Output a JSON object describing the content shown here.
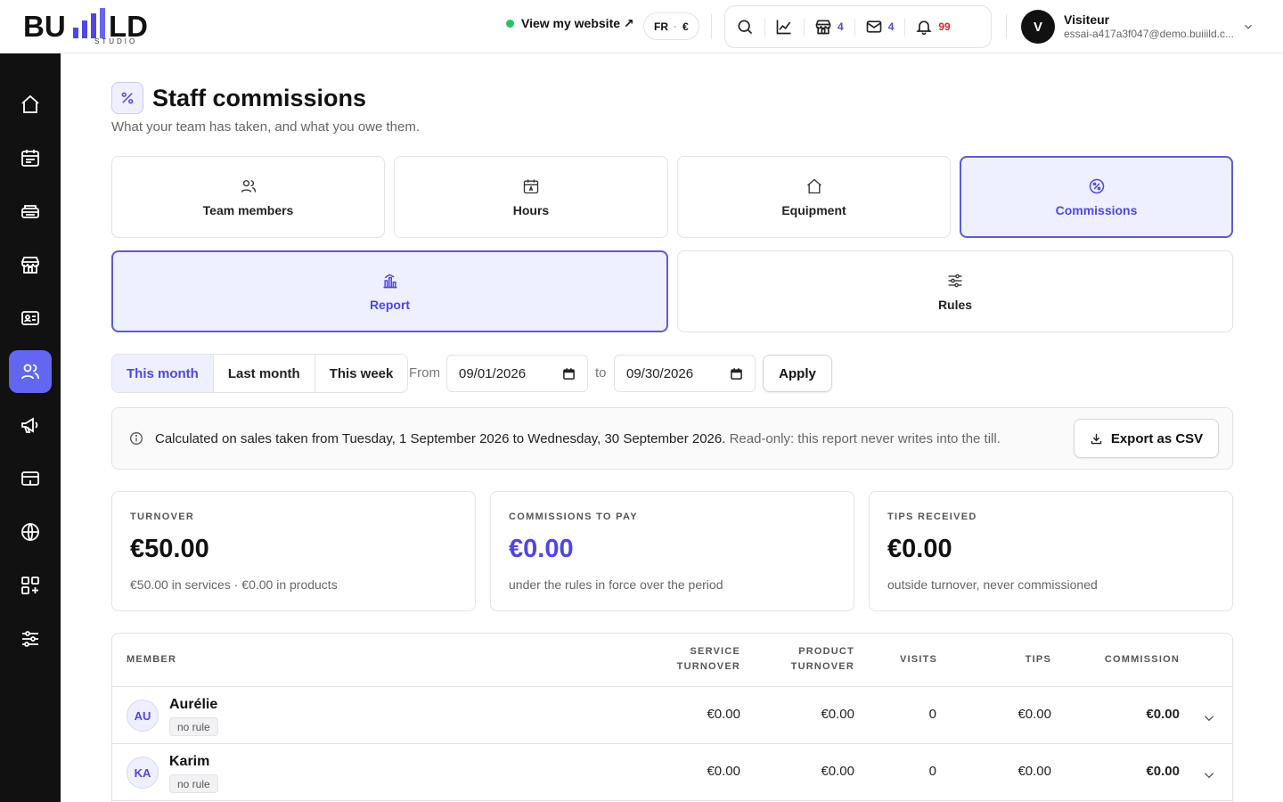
{
  "header": {
    "logo_text": "BUILD",
    "logo_sub": "STUDIO",
    "view_site": "View my website ↗",
    "lang": "FR",
    "currency": "€",
    "icons": [
      {
        "name": "search-icon",
        "count": ""
      },
      {
        "name": "chart-icon",
        "count": ""
      },
      {
        "name": "store-icon",
        "count": "4"
      },
      {
        "name": "mail-icon",
        "count": "4"
      },
      {
        "name": "bell-icon",
        "count": "99"
      }
    ],
    "user": {
      "initial": "V",
      "name": "Visiteur",
      "email": "essai-a417a3f047@demo.buiiild.c..."
    }
  },
  "sidebar": {
    "items": [
      "home",
      "calendar",
      "register",
      "store",
      "contact-card",
      "team",
      "megaphone",
      "card",
      "globe",
      "apps",
      "sliders"
    ],
    "active": "team"
  },
  "page": {
    "title": "Staff commissions",
    "subtitle": "What your team has taken, and what you owe them."
  },
  "tabs": [
    {
      "label": "Team members",
      "icon": "users-icon",
      "active": false
    },
    {
      "label": "Hours",
      "icon": "calendar-icon",
      "active": false
    },
    {
      "label": "Equipment",
      "icon": "home-icon",
      "active": false
    },
    {
      "label": "Commissions",
      "icon": "percent-icon",
      "active": true
    }
  ],
  "subtabs": [
    {
      "label": "Report",
      "icon": "bar-chart-icon",
      "active": true
    },
    {
      "label": "Rules",
      "icon": "sliders-icon",
      "active": false
    }
  ],
  "filters": {
    "ranges": [
      {
        "label": "This month",
        "active": true
      },
      {
        "label": "Last month",
        "active": false
      },
      {
        "label": "This week",
        "active": false
      }
    ],
    "from_label": "From",
    "from_value": "09/01/2026",
    "to_label": "to",
    "to_value": "09/30/2026",
    "apply": "Apply"
  },
  "info": {
    "text": "Calculated on sales taken from Tuesday, 1 September 2026 to Wednesday, 30 September 2026.",
    "muted": "Read-only: this report never writes into the till.",
    "export": "Export as CSV"
  },
  "stats": [
    {
      "label": "TURNOVER",
      "value": "€50.00",
      "note": "€50.00 in services · €0.00 in products",
      "accent": false
    },
    {
      "label": "COMMISSIONS TO PAY",
      "value": "€0.00",
      "note": "under the rules in force over the period",
      "accent": true
    },
    {
      "label": "TIPS RECEIVED",
      "value": "€0.00",
      "note": "outside turnover, never commissioned",
      "accent": false
    }
  ],
  "table": {
    "headers": {
      "member": "MEMBER",
      "service_1": "SERVICE",
      "service_2": "TURNOVER",
      "product_1": "PRODUCT",
      "product_2": "TURNOVER",
      "visits": "VISITS",
      "tips": "TIPS",
      "commission": "COMMISSION"
    },
    "rows": [
      {
        "initials": "AU",
        "name": "Aurélie",
        "badge": "no rule",
        "service": "€0.00",
        "product": "€0.00",
        "visits": "0",
        "tips": "€0.00",
        "commission": "€0.00"
      },
      {
        "initials": "KA",
        "name": "Karim",
        "badge": "no rule",
        "service": "€0.00",
        "product": "€0.00",
        "visits": "0",
        "tips": "€0.00",
        "commission": "€0.00"
      }
    ]
  },
  "colors": {
    "accent": "#4f46e5",
    "accent_bg": "#eef0ff",
    "sidebar": "#111111",
    "online": "#22c55e",
    "alert": "#dc2626"
  }
}
